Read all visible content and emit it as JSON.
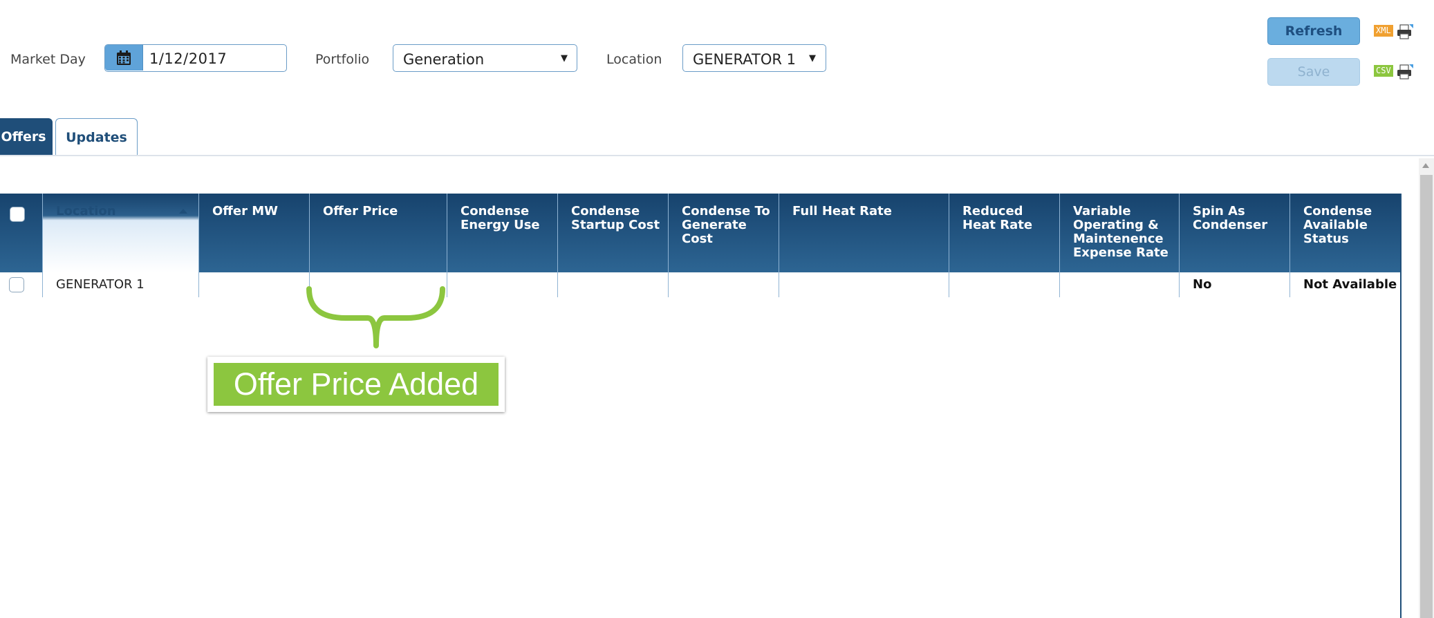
{
  "filters": {
    "market_day_label": "Market Day",
    "market_day_value": "1/12/2017",
    "portfolio_label": "Portfolio",
    "portfolio_value": "Generation",
    "location_label": "Location",
    "location_value": "GENERATOR 1"
  },
  "actions": {
    "refresh_label": "Refresh",
    "save_label": "Save",
    "xml_label": "XML",
    "csv_label": "CSV"
  },
  "tabs": [
    {
      "label": "Offers",
      "active": true
    },
    {
      "label": "Updates",
      "active": false
    }
  ],
  "grid": {
    "columns": [
      "Location",
      "Offer MW",
      "Offer Price",
      "Condense Energy Use",
      "Condense Startup Cost",
      "Condense To Generate Cost",
      "Full Heat Rate",
      "Reduced Heat Rate",
      "Variable Operating & Maintenence Expense Rate",
      "Spin As Condenser",
      "Condense Available Status"
    ],
    "sorted_column": "Location",
    "sort_direction": "ascending",
    "rows": [
      [
        "GENERATOR 1",
        "",
        "",
        "",
        "",
        "",
        "",
        "",
        "",
        "No",
        "Not Available"
      ]
    ]
  },
  "annotation": {
    "text": "Offer Price Added"
  },
  "colors": {
    "header_blue": "#1f4e79",
    "button_blue": "#6aaede",
    "callout_green": "#8cc63f",
    "xml_orange": "#f0a030",
    "csv_green": "#8cc63f"
  }
}
